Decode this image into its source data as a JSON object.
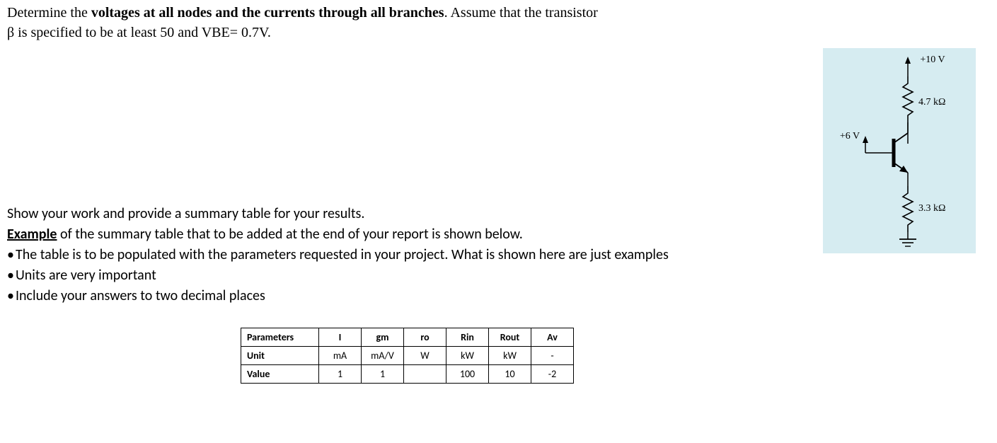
{
  "question": {
    "prefix": "Determine the ",
    "bold_part": "voltages at all nodes and the currents through all branches",
    "suffix": ". Assume that the transistor",
    "line2": "β is specified to be at least 50 and VBE= 0.7V."
  },
  "body": {
    "line1": "Show your work and provide a summary table for your results.",
    "line2_bold": "Example",
    "line2_rest": " of the summary table that to be added at the end of your report is shown below.",
    "bullet1": "The table is to be populated with the parameters requested in your project. What is shown here are just examples",
    "bullet2": "Units are very important",
    "bullet3": "Include your answers to two decimal places"
  },
  "circuit": {
    "top_label": "+10 V",
    "r_top": "4.7 kΩ",
    "base_label": "+6 V",
    "r_bottom": "3.3 kΩ"
  },
  "chart_data": {
    "type": "table",
    "headers": [
      "Parameters",
      "I",
      "gm",
      "ro",
      "Rin",
      "Rout",
      "Av"
    ],
    "rows": [
      [
        "Unit",
        "mA",
        "mA/V",
        "W",
        "kW",
        "kW",
        "-"
      ],
      [
        "Value",
        "1",
        "1",
        "",
        "100",
        "10",
        "-2"
      ]
    ]
  }
}
